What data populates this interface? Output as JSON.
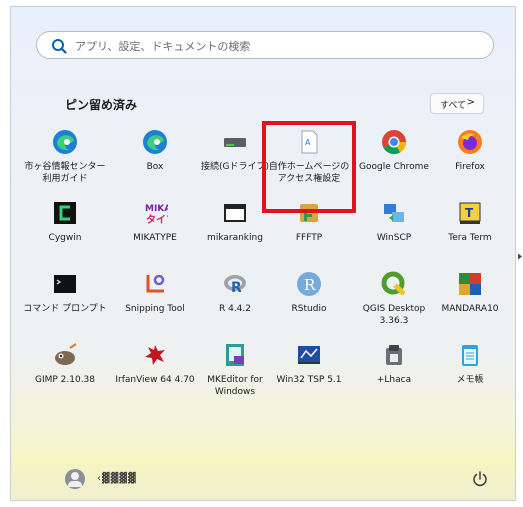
{
  "search": {
    "placeholder": "アプリ、設定、ドキュメントの検索"
  },
  "pinned": {
    "title": "ピン留め済み",
    "all_label": "すべて",
    "all_chevron": ">",
    "apps": [
      {
        "label1": "市ヶ谷情報センター",
        "label2": "利用ガイド",
        "icon": "edge-icon"
      },
      {
        "label1": "Box",
        "label2": "",
        "icon": "edge-icon"
      },
      {
        "label1": "接続(Gドライブ)",
        "label2": "",
        "icon": "drive-icon"
      },
      {
        "label1": "自作ホームページの",
        "label2": "アクセス権設定",
        "icon": "document-icon"
      },
      {
        "label1": "Google Chrome",
        "label2": "",
        "icon": "chrome-icon"
      },
      {
        "label1": "Firefox",
        "label2": "",
        "icon": "firefox-icon"
      },
      {
        "label1": "Cygwin",
        "label2": "",
        "icon": "cygwin-icon"
      },
      {
        "label1": "MIKATYPE",
        "label2": "",
        "icon": "mikatype-icon"
      },
      {
        "label1": "mikaranking",
        "label2": "",
        "icon": "window-icon"
      },
      {
        "label1": "FFFTP",
        "label2": "",
        "icon": "ffftp-icon"
      },
      {
        "label1": "WinSCP",
        "label2": "",
        "icon": "winscp-icon"
      },
      {
        "label1": "Tera Term",
        "label2": "",
        "icon": "teraterm-icon"
      },
      {
        "label1": "コマンド プロンプト",
        "label2": "",
        "icon": "cmd-icon"
      },
      {
        "label1": "Snipping Tool",
        "label2": "",
        "icon": "snipping-icon"
      },
      {
        "label1": "R 4.4.2",
        "label2": "",
        "icon": "r-icon"
      },
      {
        "label1": "RStudio",
        "label2": "",
        "icon": "rstudio-icon"
      },
      {
        "label1": "QGIS Desktop",
        "label2": "3.36.3",
        "icon": "qgis-icon"
      },
      {
        "label1": "MANDARA10",
        "label2": "",
        "icon": "mandara-icon"
      },
      {
        "label1": "GIMP 2.10.38",
        "label2": "",
        "icon": "gimp-icon"
      },
      {
        "label1": "IrfanView 64 4.70",
        "label2": "",
        "icon": "irfanview-icon"
      },
      {
        "label1": "MKEditor for",
        "label2": "Windows",
        "icon": "mkeditor-icon"
      },
      {
        "label1": "Win32 TSP 5.1",
        "label2": "",
        "icon": "tsp-icon"
      },
      {
        "label1": "+Lhaca",
        "label2": "",
        "icon": "lhaca-icon"
      },
      {
        "label1": "メモ帳",
        "label2": "",
        "icon": "notepad-icon"
      }
    ]
  },
  "user": {
    "name": "‹▓▓▓▓"
  },
  "colors": {
    "highlight": "#e0151b",
    "accent": "#0067c0"
  }
}
